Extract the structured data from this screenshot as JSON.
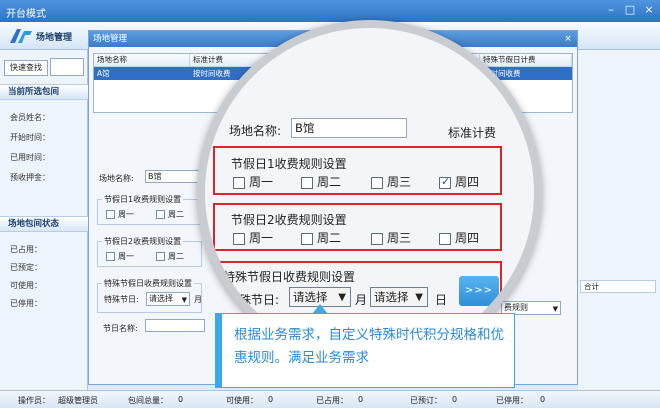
{
  "window": {
    "title": "开台模式",
    "min": "–",
    "max": "□",
    "close": "×"
  },
  "toolbar": {
    "venue_mgmt": "场地管理"
  },
  "left": {
    "quick_search": "快速查找",
    "current_section": "当前所选包间",
    "member_name": "会员姓名：",
    "start_time": "开始时间：",
    "used_time": "已用时间：",
    "deposit": "预收押金：",
    "status_section": "场地包间状态",
    "occupied": "已占用：",
    "reserved": "已预定：",
    "available": "可使用：",
    "disabled": "已停用："
  },
  "dialog": {
    "title": "场地管理",
    "close": "×",
    "columns": [
      "场地名称",
      "标准计费",
      "特殊节假日计费"
    ],
    "row": [
      "A馆",
      "按时间收费",
      "按时间收费"
    ],
    "venue_label": "场地名称:",
    "venue_value": "B馆",
    "holiday1": "节假日1收费规则设置",
    "holiday2": "节假日2收费规则设置",
    "special": "特殊节假日收费规则设置",
    "special_day": "特殊节日:",
    "select": "请选择",
    "month": "月",
    "holiday_name": "节日名称:",
    "mon": "周一",
    "tue": "周二",
    "right_header": "合计",
    "right_rule": "费规则"
  },
  "magnifier": {
    "venue_label": "场地名称:",
    "venue_value": "B馆",
    "standard_fee": "标准计费",
    "holiday1": "节假日1收费规则设置",
    "holiday2": "节假日2收费规则设置",
    "special": "特殊节假日收费规则设置",
    "days": [
      "周一",
      "周二",
      "周三",
      "周四"
    ],
    "special_day": "特殊节日:",
    "select_month": "请选择",
    "month": "月",
    "select_day": "请选择",
    "day": "日",
    "go": ">>>"
  },
  "callout": {
    "text": "根据业务需求，自定义特殊时代积分规格和优惠规则。满足业务需求"
  },
  "status": {
    "operator_label": "操作员：",
    "operator": "超级管理员",
    "total": "包间总量：",
    "total_v": "0",
    "avail": "可使用：",
    "avail_v": "0",
    "occ": "已占用：",
    "occ_v": "0",
    "res": "已预订：",
    "res_v": "0",
    "dis": "已停用：",
    "dis_v": "0"
  }
}
